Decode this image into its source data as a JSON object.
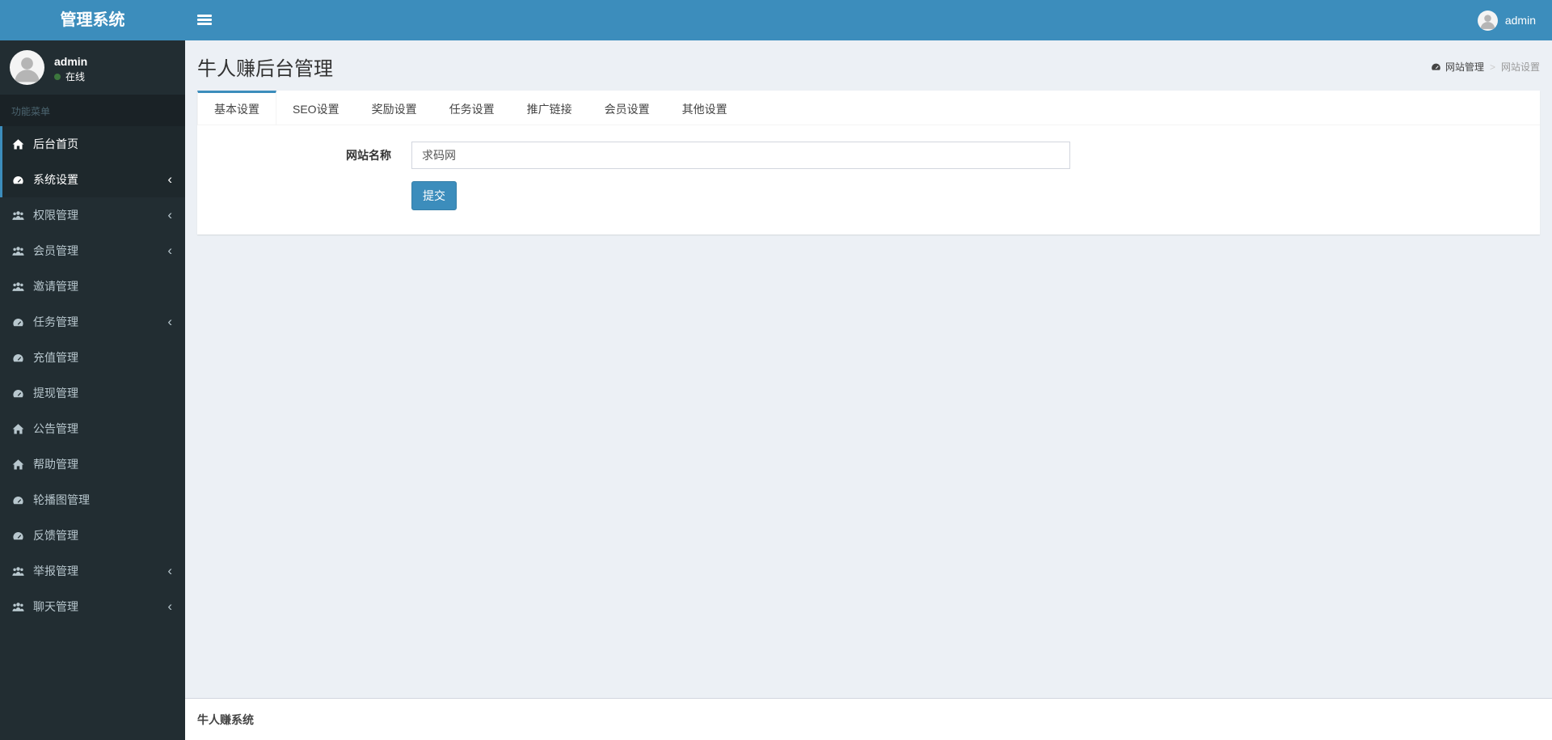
{
  "header": {
    "logo": "管理系统",
    "user_name": "admin"
  },
  "sidebar": {
    "user": {
      "name": "admin",
      "status": "在线"
    },
    "section_label": "功能菜单",
    "items": [
      {
        "label": "后台首页",
        "icon": "home-icon",
        "active": true,
        "has_submenu": false
      },
      {
        "label": "系统设置",
        "icon": "dashboard-icon",
        "active": true,
        "has_submenu": true
      },
      {
        "label": "权限管理",
        "icon": "users-icon",
        "active": false,
        "has_submenu": true
      },
      {
        "label": "会员管理",
        "icon": "users-icon",
        "active": false,
        "has_submenu": true
      },
      {
        "label": "邀请管理",
        "icon": "users-icon",
        "active": false,
        "has_submenu": false
      },
      {
        "label": "任务管理",
        "icon": "dashboard-icon",
        "active": false,
        "has_submenu": true
      },
      {
        "label": "充值管理",
        "icon": "dashboard-icon",
        "active": false,
        "has_submenu": false
      },
      {
        "label": "提现管理",
        "icon": "dashboard-icon",
        "active": false,
        "has_submenu": false
      },
      {
        "label": "公告管理",
        "icon": "home-icon",
        "active": false,
        "has_submenu": false
      },
      {
        "label": "帮助管理",
        "icon": "home-icon",
        "active": false,
        "has_submenu": false
      },
      {
        "label": "轮播图管理",
        "icon": "dashboard-icon",
        "active": false,
        "has_submenu": false
      },
      {
        "label": "反馈管理",
        "icon": "dashboard-icon",
        "active": false,
        "has_submenu": false
      },
      {
        "label": "举报管理",
        "icon": "users-icon",
        "active": false,
        "has_submenu": true
      },
      {
        "label": "聊天管理",
        "icon": "users-icon",
        "active": false,
        "has_submenu": true
      }
    ],
    "chevron_glyph": "‹"
  },
  "main": {
    "title": "牛人赚后台管理",
    "breadcrumb": {
      "parent": "网站管理",
      "separator": ">",
      "current": "网站设置"
    },
    "tabs": [
      {
        "label": "基本设置",
        "active": true
      },
      {
        "label": "SEO设置",
        "active": false
      },
      {
        "label": "奖励设置",
        "active": false
      },
      {
        "label": "任务设置",
        "active": false
      },
      {
        "label": "推广链接",
        "active": false
      },
      {
        "label": "会员设置",
        "active": false
      },
      {
        "label": "其他设置",
        "active": false
      }
    ],
    "form": {
      "site_name_label": "网站名称",
      "site_name_value": "求码网",
      "submit_label": "提交"
    }
  },
  "footer": {
    "text": "牛人赚系统"
  },
  "colors": {
    "accent": "#3c8dbc",
    "accent_dark": "#367fa9",
    "sidebar_bg": "#222d32",
    "sidebar_active_bg": "#1e282c",
    "sidebar_text": "#b8c7ce",
    "content_bg": "#ecf0f5",
    "online_dot": "#3c763d"
  }
}
